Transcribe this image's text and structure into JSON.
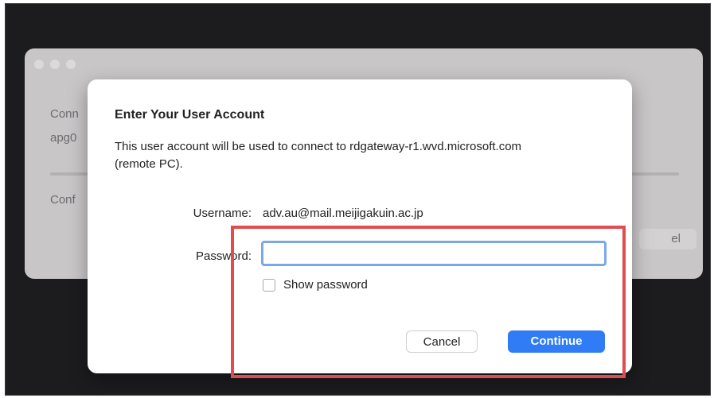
{
  "background_window": {
    "text_line_1": "Conn",
    "text_line_2": "apg0",
    "text_line_3": "Conf",
    "button_label": "el"
  },
  "dialog": {
    "title": "Enter Your User Account",
    "description": "This user account will be used to connect to rdgateway-r1.wvd.microsoft.com (remote PC).",
    "username_label": "Username:",
    "username_value": "adv.au@mail.meijigakuin.ac.jp",
    "password_label": "Password:",
    "password_value": "",
    "password_placeholder": "",
    "show_password_label": "Show password",
    "show_password_checked": false,
    "cancel_label": "Cancel",
    "continue_label": "Continue"
  },
  "colors": {
    "accent": "#2f7cf6",
    "highlight": "#e14c50",
    "focus_ring": "#7aa9e6"
  }
}
